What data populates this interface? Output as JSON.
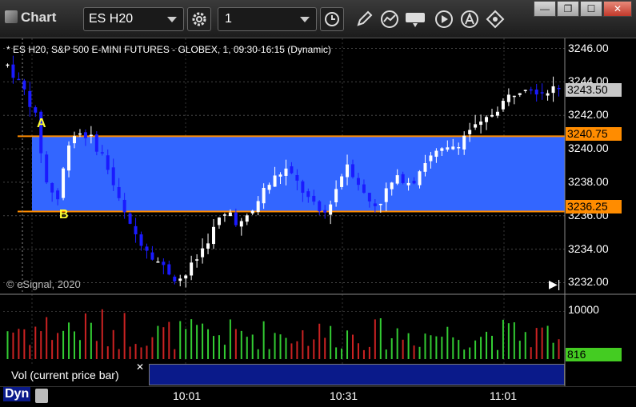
{
  "window": {
    "title": "Chart",
    "symbol": "ES H20",
    "interval": "1"
  },
  "chart_header": "* ES H20, S&P 500 E-MINI FUTURES - GLOBEX, 1, 09:30-16:15 (Dynamic)",
  "copyright": "© eSignal, 2020",
  "annotations": {
    "label_a": "A",
    "label_b": "B"
  },
  "price_axis": {
    "labels": [
      "3246.00",
      "3244.00",
      "3242.00",
      "3240.00",
      "3238.00",
      "3236.00",
      "3234.00",
      "3232.00"
    ],
    "last_price_tag": "3243.50",
    "line_upper_tag": "3240.75",
    "line_lower_tag": "3236.25"
  },
  "volume_axis": {
    "label": "10000",
    "current_tag": "816"
  },
  "volume_study_label": "Vol (current price bar)",
  "time_axis": {
    "labels": [
      "10:01",
      "10:31",
      "11:01"
    ]
  },
  "bottom": {
    "mode_label": "Dyn"
  },
  "colors": {
    "up_candle": "#ffffff",
    "down_candle": "#1a1aff",
    "band_fill": "#3366ff",
    "band_lines": "#ff8c00",
    "last_price_tag_bg": "#c8c8c8",
    "volume_up": "#33cc33",
    "volume_down": "#cc2222",
    "volume_tag_bg": "#44cc22"
  },
  "chart_data": {
    "type": "candlestick",
    "price_range": [
      3231.4,
      3246.6
    ],
    "band": {
      "upper": 3240.75,
      "lower": 3236.25
    },
    "volume_range": [
      0,
      12000
    ],
    "candles": []
  }
}
